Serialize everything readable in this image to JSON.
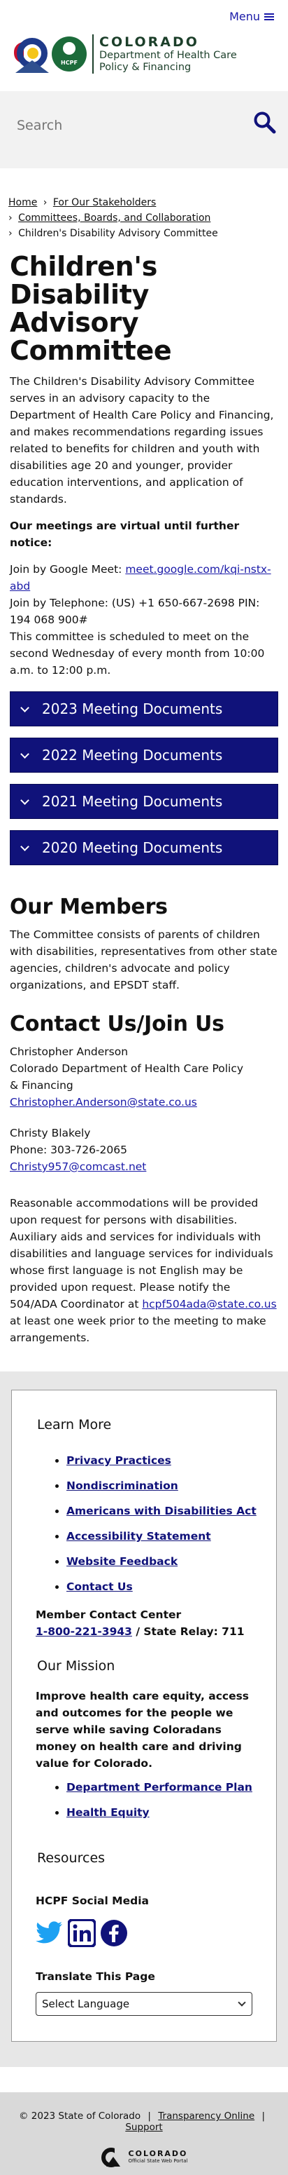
{
  "header": {
    "menu_label": "Menu",
    "hcpf_badge": "HCPF",
    "brand_line1": "COLORADO",
    "brand_line2": "Department of Health Care",
    "brand_line3": "Policy & Financing"
  },
  "search": {
    "placeholder": "Search"
  },
  "breadcrumb": {
    "home": "Home",
    "stakeholders": "For Our Stakeholders",
    "committees": "Committees, Boards, and Collaboration",
    "current": "Children's Disability Advisory Committee",
    "separator": "›"
  },
  "page": {
    "title": "Children's Disability Advisory Committee",
    "intro": "The Children's Disability Advisory Committee serves in an advisory capacity to the Department of Health Care Policy and Financing, and makes recommendations regarding issues related to benefits for children and youth with disabilities age 20 and younger, provider education interventions, and application of standards.",
    "virtual_notice": "Our meetings are virtual until further notice:",
    "google_meet_label": "Join by Google Meet: ",
    "google_meet_link": "meet.google.com/kqi-nstx-abd",
    "phone_label": "Join by Telephone:  (US) +1 650-667-2698 PIN: 194 068 900#",
    "schedule": "This committee is scheduled to meet on the second Wednesday of every month from 10:00 a.m. to 12:00 p.m."
  },
  "accordions": [
    {
      "label": "2023 Meeting Documents"
    },
    {
      "label": "2022 Meeting Documents"
    },
    {
      "label": "2021 Meeting Documents"
    },
    {
      "label": "2020 Meeting Documents"
    }
  ],
  "members": {
    "heading": "Our Members",
    "text": "The Committee consists of parents of children with disabilities, representatives from other state agencies, children's advocate and policy organizations, and EPSDT staff."
  },
  "contact": {
    "heading": "Contact Us/Join Us",
    "c1_name": "Christopher Anderson",
    "c1_org1": "Colorado Department of Health Care Policy",
    "c1_org2": "& Financing",
    "c1_email": "Christopher.Anderson@state.co.us",
    "c2_name": "Christy Blakely",
    "c2_phone": "Phone: 303-726-2065",
    "c2_email": "Christy957@comcast.net"
  },
  "accommodations": {
    "text_a": "Reasonable accommodations will be provided upon request for persons with disabilities.  Auxiliary aids and services for individuals with disabilities and language services for individuals whose first language is not English may be provided upon request.  Please notify the 504/ADA Coordinator at ",
    "email": "hcpf504ada@state.co.us",
    "text_b": " at least one week prior to the meeting to make arrangements."
  },
  "footer": {
    "learn_more": "Learn More",
    "links": [
      "Privacy Practices",
      "Nondiscrimination",
      "Americans with Disabilities Act",
      "Accessibility Statement",
      "Website Feedback",
      "Contact Us"
    ],
    "mcc_label": "Member Contact Center",
    "mcc_phone": "1-800-221-3943",
    "mcc_relay": " / State Relay: 711",
    "mission_heading": "Our Mission",
    "mission_text": "Improve health care equity, access and outcomes for the people we serve while saving Coloradans money on health care and driving value for Colorado.",
    "mission_links": [
      "Department Performance Plan",
      "Health Equity"
    ],
    "resources": "Resources",
    "social_heading": "HCPF Social Media",
    "social": [
      "twitter-icon",
      "linkedin-icon",
      "facebook-icon"
    ],
    "translate_heading": "Translate This Page",
    "translate_select": "Select Language"
  },
  "bottom": {
    "copyright": "© 2023 State of Colorado",
    "transparency": "Transparency Online",
    "support": "Support",
    "portal_l1": "COLORADO",
    "portal_l2": "Official State Web Portal"
  },
  "colors": {
    "brand_navy": "#10127a",
    "hcpf_green": "#1c6b3a",
    "footer_bg": "#e7e7e7"
  }
}
